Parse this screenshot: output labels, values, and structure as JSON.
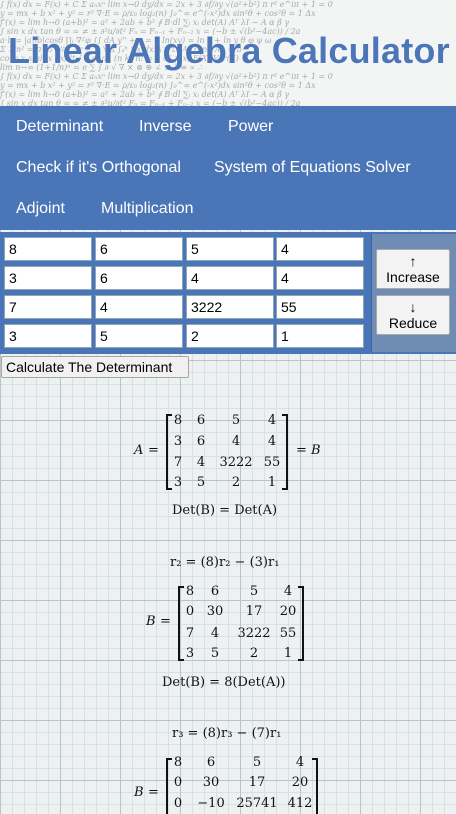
{
  "header": {
    "title": "Linear Algebra Calculator",
    "scribble_lines": [
      "∫ f(x) dx = F(x) + C   Σ aₙxⁿ   lim x→0   dy/dx = 2x + 3   ∂f/∂y   √(a²+b²)   π r²   e^iπ + 1 = 0",
      "y = mx + b   x² + y² = r²   ∇·E = ρ/ε₀   log₂(n)   ∫₀^∞ e^(-x²)dx   sin²θ + cos²θ = 1   Δx",
      "f'(x) = lim h→0   (a+b)² = a² + 2ab + b²   ∮ B·dl   ∑ᵢ xᵢ   det(A)   Aᵀ   λI − A   α β γ",
      "∫ sin x dx   tan θ   ∞   ≈   ≠   ±   ∂²u/∂t²   Fₙ = Fₙ₋₁ + Fₙ₋₂   x = (−b ± √(b²−4ac)) / 2a",
      "a·b = |a||b|cosθ   ∏ᵢ   ∇²φ   ∫∫ dA   y'' + y = 0   ln(xy) = ln x + ln y   θ φ ψ ω",
      "Σ 1/n²  = π²/6   ∂/∂x   ℝⁿ   ∈   ⊂   ∀ ∃   ∫ₐᵇ f(x)dx   A⁻¹   tr(A)   rank   Ax = b",
      "cosh x   sinh x   dx/dt   ∫ x eˣ dx   (n k)   n!   ∞   μ σ²   p(x)   E[X]   Var(X)",
      "lim n→∞ (1+1/n)ⁿ = e   ∑   ∫   ∂   √   ∇   ×   ⊗   ⊕   ∠   ⊥   ∥   ≡   ∝   ∴"
    ]
  },
  "nav": {
    "items": [
      "Determinant",
      "Inverse",
      "Power",
      "Check if it's Orthogonal",
      "System of Equations Solver",
      "Adjoint",
      "Multiplication"
    ]
  },
  "matrix_input": {
    "rows": [
      [
        "8",
        "6",
        "5",
        "4"
      ],
      [
        "3",
        "6",
        "4",
        "4"
      ],
      [
        "7",
        "4",
        "3222",
        "55"
      ],
      [
        "3",
        "5",
        "2",
        "1"
      ]
    ]
  },
  "controls": {
    "increase_arrow": "↑",
    "increase_label": "Increase",
    "reduce_arrow": "↓",
    "reduce_label": "Reduce",
    "calculate_label": "Calculate The Determinant"
  },
  "solution": {
    "step0": {
      "lhs": "A",
      "eq": "=",
      "rhs_eq": "=",
      "rhs": "B",
      "matrix": [
        [
          "8",
          "6",
          "5",
          "4"
        ],
        [
          "3",
          "6",
          "4",
          "4"
        ],
        [
          "7",
          "4",
          "3222",
          "55"
        ],
        [
          "3",
          "5",
          "2",
          "1"
        ]
      ],
      "det_line": "Det(B) = Det(A)"
    },
    "step1": {
      "op": "r₂ = (8)r₂ − (3)r₁",
      "lhs": "B",
      "eq": "=",
      "matrix": [
        [
          "8",
          "6",
          "5",
          "4"
        ],
        [
          "0",
          "30",
          "17",
          "20"
        ],
        [
          "7",
          "4",
          "3222",
          "55"
        ],
        [
          "3",
          "5",
          "2",
          "1"
        ]
      ],
      "det_line": "Det(B) = 8(Det(A))"
    },
    "step2": {
      "op": "r₃ = (8)r₃ − (7)r₁",
      "lhs": "B",
      "eq": "=",
      "matrix": [
        [
          "8",
          "6",
          "5",
          "4"
        ],
        [
          "0",
          "30",
          "17",
          "20"
        ],
        [
          "0",
          "−10",
          "25741",
          "412"
        ]
      ]
    }
  }
}
